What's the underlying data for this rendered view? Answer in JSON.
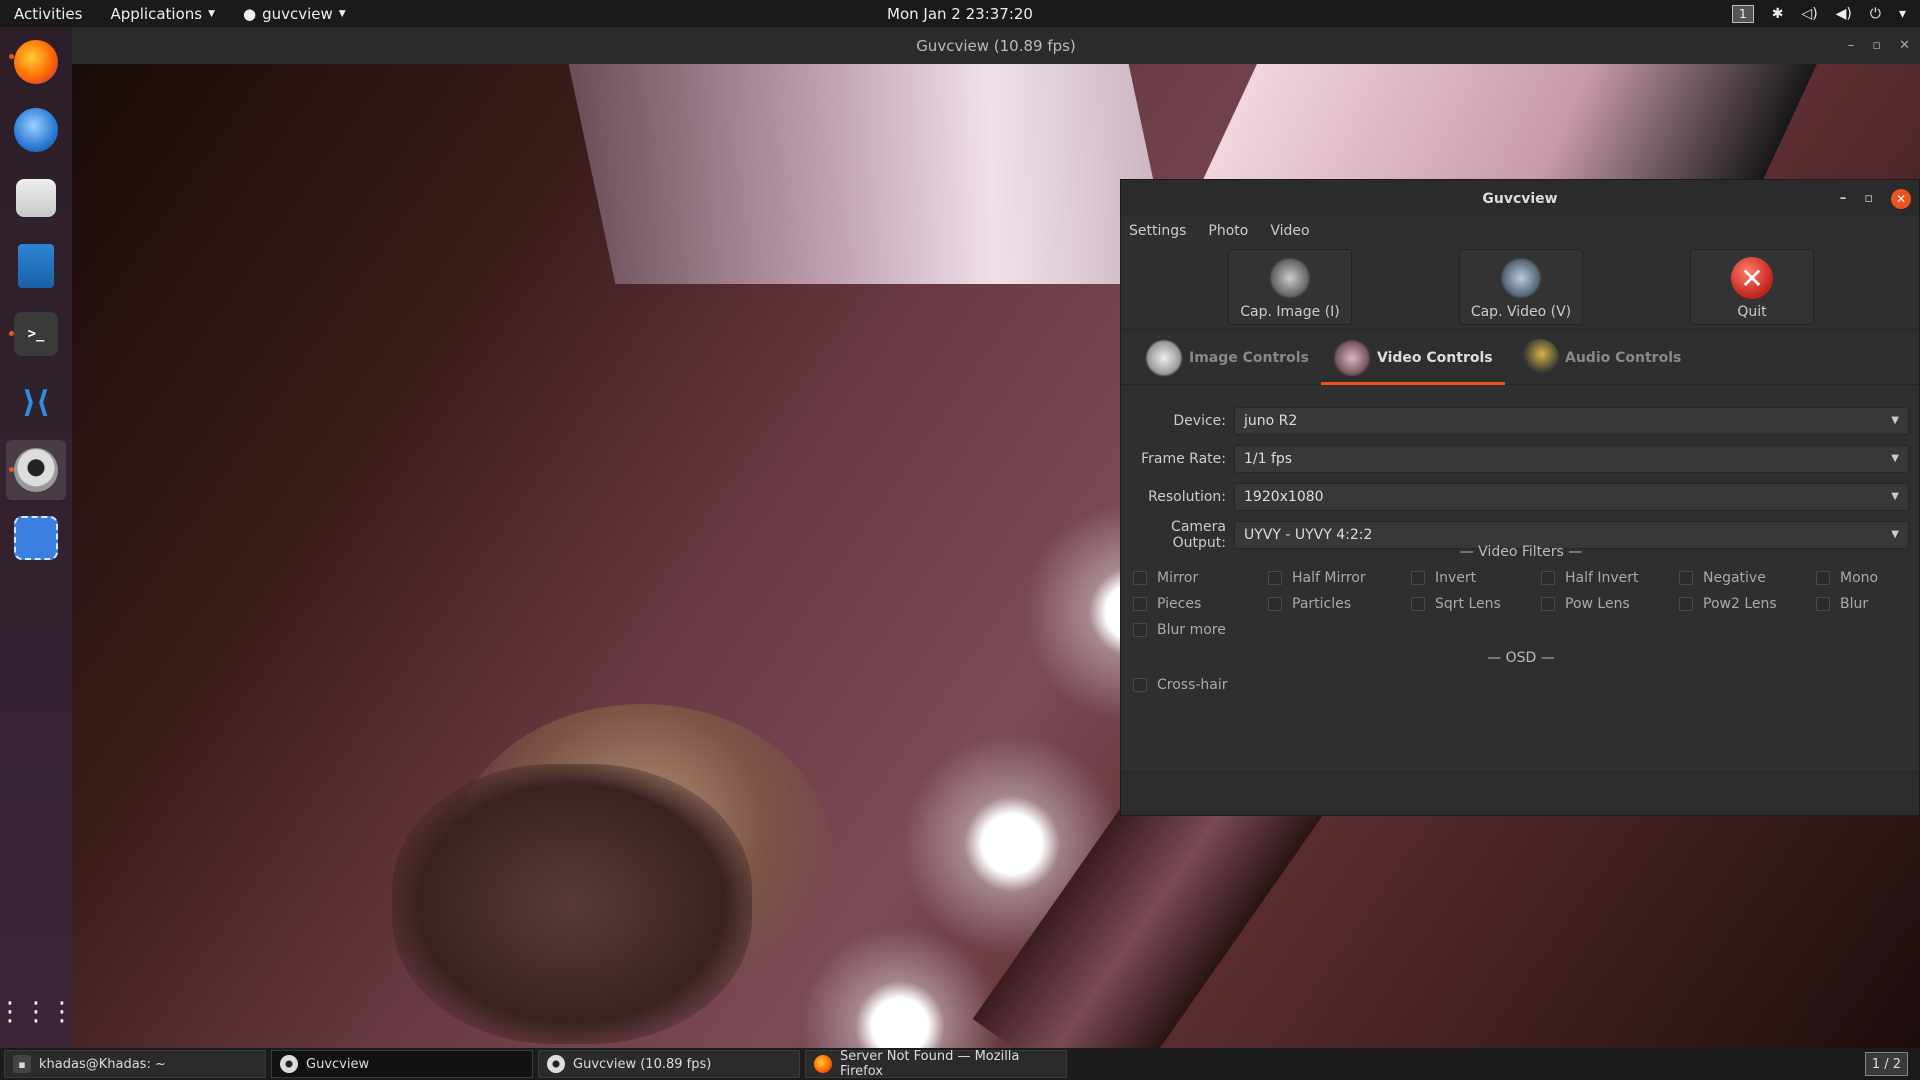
{
  "topbar": {
    "activities": "Activities",
    "applications": "Applications",
    "app_menu": "guvcview",
    "clock": "Mon Jan 2  23:37:20",
    "workspace": "1"
  },
  "dock": {
    "items": [
      {
        "name": "firefox",
        "label": ""
      },
      {
        "name": "thunderbird",
        "label": ""
      },
      {
        "name": "files",
        "label": ""
      },
      {
        "name": "writer",
        "label": ""
      },
      {
        "name": "terminal",
        "label": ">_"
      },
      {
        "name": "vscode",
        "label": "⟩⟨"
      },
      {
        "name": "guvcview",
        "label": ""
      },
      {
        "name": "screenshot",
        "label": ""
      }
    ],
    "apps_grid": "⋮⋮⋮"
  },
  "video_window": {
    "title": "Guvcview  (10.89 fps)"
  },
  "controls": {
    "title": "Guvcview",
    "menu": [
      "Settings",
      "Photo",
      "Video"
    ],
    "toolbar": {
      "cap_image": "Cap. Image (I)",
      "cap_video": "Cap. Video (V)",
      "quit": "Quit"
    },
    "tabs": [
      "Image Controls",
      "Video Controls",
      "Audio Controls"
    ],
    "active_tab": "Video Controls",
    "fields": {
      "device": {
        "label": "Device:",
        "value": "juno R2"
      },
      "frame_rate": {
        "label": "Frame Rate:",
        "value": "1/1 fps"
      },
      "resolution": {
        "label": "Resolution:",
        "value": "1920x1080"
      },
      "camera_output": {
        "label": "Camera Output:",
        "value": "UYVY - UYVY 4:2:2"
      }
    },
    "video_filters_title": "— Video Filters —",
    "filters": [
      "Mirror",
      "Half Mirror",
      "Invert",
      "Half Invert",
      "Negative",
      "Mono",
      "Pieces",
      "Particles",
      "Sqrt Lens",
      "Pow Lens",
      "Pow2 Lens",
      "Blur",
      "Blur more"
    ],
    "osd_title": "— OSD —",
    "osd": [
      "Cross-hair"
    ]
  },
  "taskbar": {
    "tasks": [
      "khadas@Khadas: ~",
      "Guvcview",
      "Guvcview  (10.89 fps)",
      "Server Not Found — Mozilla Firefox"
    ],
    "pager": "1 / 2"
  },
  "colors": {
    "accent": "#e95420",
    "panel": "#2f2f2f",
    "topbar": "#1a1a1a"
  }
}
